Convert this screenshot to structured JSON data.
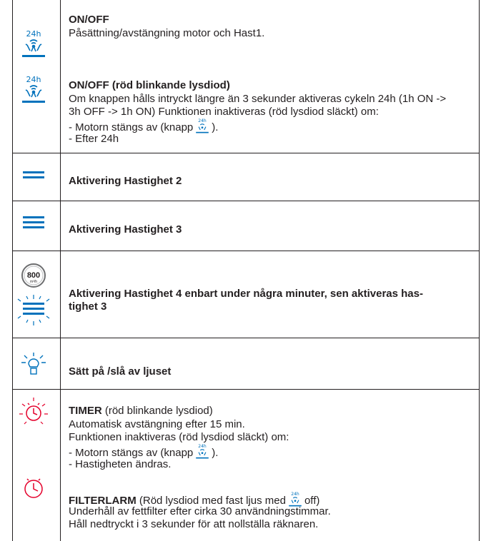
{
  "colors": {
    "blue": "#0072bc",
    "red": "#e4002b",
    "text": "#231f20",
    "border": "#231f20"
  },
  "rows": {
    "onoff": {
      "icon": "fan-24h-icon",
      "icon_label": "24h",
      "title": "ON/OFF",
      "line1": "Påsättning/avstängning motor och Hast1."
    },
    "onoff_red": {
      "icon": "fan-24h-icon",
      "icon_label": "24h",
      "title": "ON/OFF (röd blinkande lysdiod)",
      "line1": "Om knappen hålls intryckt längre än 3 sekunder aktiveras cykeln 24h (1h ON ->",
      "line2": "3h OFF -> 1h ON) Funktionen inaktiveras (röd lysdiod släckt) om:",
      "line3_a": "- Motorn stängs av (knapp",
      "line3_b": ").",
      "line4": "- Efter 24h"
    },
    "speed2": {
      "icon": "two-bars-icon",
      "title": "Aktivering Hastighet 2"
    },
    "speed3": {
      "icon": "three-bars-icon",
      "title": "Aktivering Hastighet 3"
    },
    "speed4": {
      "icon": "speed-800-icon",
      "badge_value": "800",
      "badge_unit": "m³/h",
      "title_line1": "Aktivering Hastighet 4 enbart under några minuter, sen aktiveras has-",
      "title_line2": "tighet 3"
    },
    "light": {
      "icon": "lightbulb-icon",
      "title": "Sätt på /slå av ljuset"
    },
    "timer": {
      "title": "TIMER",
      "title_suffix": " (röd blinkande lysdiod)",
      "line1": "Automatisk avstängning efter 15 min.",
      "line2": "Funktionen inaktiveras (röd lysdiod släckt) om:",
      "line3_a": "- Motorn stängs av (knapp",
      "line3_b": ").",
      "line4": "- Hastigheten ändras."
    },
    "filter": {
      "title": "FILTERLARM",
      "title_suffix_a": " (Röd lysdiod med fast ljus med",
      "title_suffix_b": "off)",
      "line1": "Underhåll av fettfilter efter cirka 30 användningstimmar.",
      "line2": "Håll nedtryckt i 3 sekunder för att nollställa räknaren."
    }
  }
}
